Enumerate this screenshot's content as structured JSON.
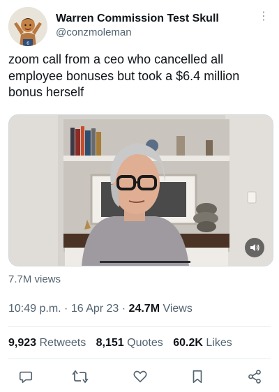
{
  "author": {
    "display_name": "Warren Commission Test Skull",
    "handle": "@conzmoleman"
  },
  "tweet": {
    "text": "zoom call from a ceo who cancelled all employee bonuses but took a $6.4 million bonus herself"
  },
  "media": {
    "views": "7.7M views"
  },
  "meta": {
    "time": "10:49 p.m.",
    "sep1": " · ",
    "date": "16 Apr 23",
    "sep2": " · ",
    "views_count": "24.7M",
    "views_label": " Views"
  },
  "stats": {
    "retweets_count": "9,923",
    "retweets_label": "Retweets",
    "quotes_count": "8,151",
    "quotes_label": "Quotes",
    "likes_count": "60.2K",
    "likes_label": "Likes"
  },
  "icons": [
    "avatar-cartoon",
    "more-icon",
    "volume-icon",
    "reply-icon",
    "retweet-icon",
    "like-icon",
    "bookmark-icon",
    "share-icon"
  ],
  "colors": {
    "text": "#0f1419",
    "secondary": "#536471",
    "divider": "#e6ecf0"
  }
}
